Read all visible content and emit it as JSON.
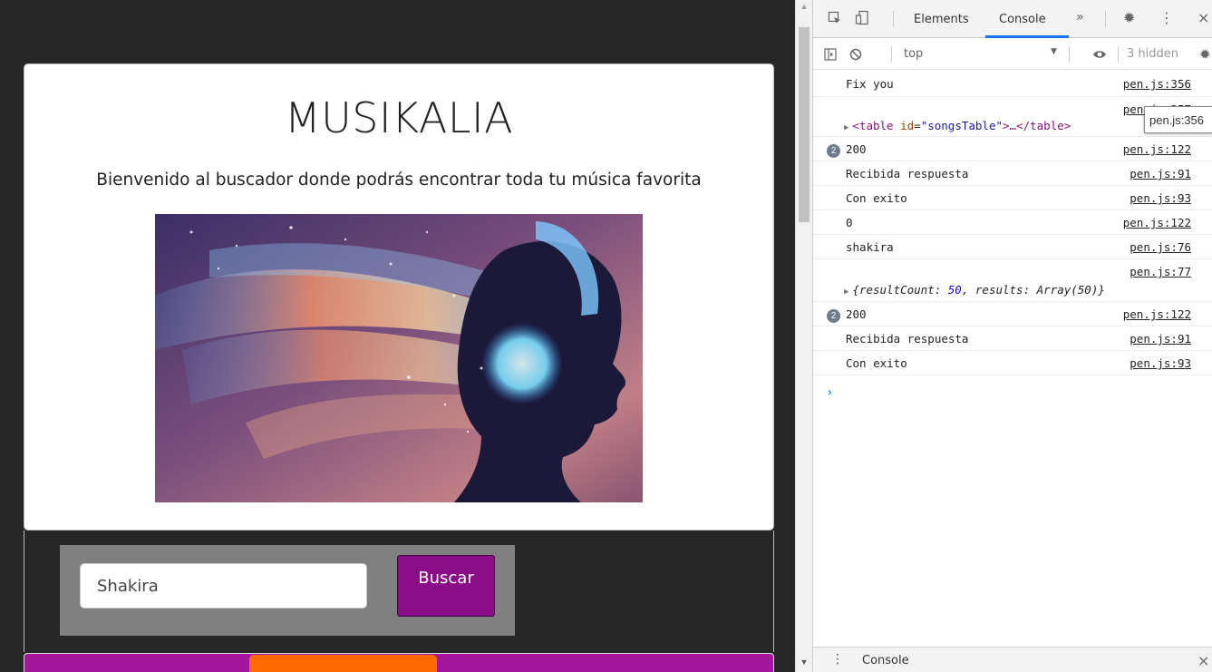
{
  "page": {
    "title": "MUSIKALIA",
    "subtitle": "Bienvenido al buscador donde podrás encontrar toda tu música favorita",
    "search": {
      "value": "Shakira",
      "button_label": "Buscar"
    },
    "colors": {
      "button": "#8b0c87",
      "bottom_bar": "#a3179f",
      "bottom_tab": "#ff6a00",
      "panel": "#808080",
      "background": "#262626"
    }
  },
  "devtools": {
    "tabs": {
      "elements": "Elements",
      "console": "Console",
      "more": "»"
    },
    "toolbar": {
      "context": "top",
      "hidden": "3 hidden"
    },
    "tooltip": "pen.js:356",
    "log": [
      {
        "msg": "Fix you",
        "src": "pen.js:356"
      },
      {
        "src": "pen.js:357",
        "element": {
          "tag_open": "<table",
          "attr": "id",
          "value": "\"songsTable\"",
          "rest": ">…</table>"
        }
      },
      {
        "count": "2",
        "msg": "200",
        "src": "pen.js:122"
      },
      {
        "msg": "Recibida respuesta",
        "src": "pen.js:91"
      },
      {
        "msg": "Con exito",
        "src": "pen.js:93"
      },
      {
        "msg": "0",
        "src": "pen.js:122"
      },
      {
        "msg": "shakira",
        "src": "pen.js:76"
      },
      {
        "src": "pen.js:77",
        "object": {
          "open": "{resultCount: ",
          "count": "50",
          "mid": ", results: Array(50)}"
        }
      },
      {
        "count": "2",
        "msg": "200",
        "src": "pen.js:122"
      },
      {
        "msg": "Recibida respuesta",
        "src": "pen.js:91"
      },
      {
        "msg": "Con exito",
        "src": "pen.js:93"
      }
    ],
    "prompt": "›",
    "drawer": {
      "title": "Console",
      "close": "×"
    }
  }
}
